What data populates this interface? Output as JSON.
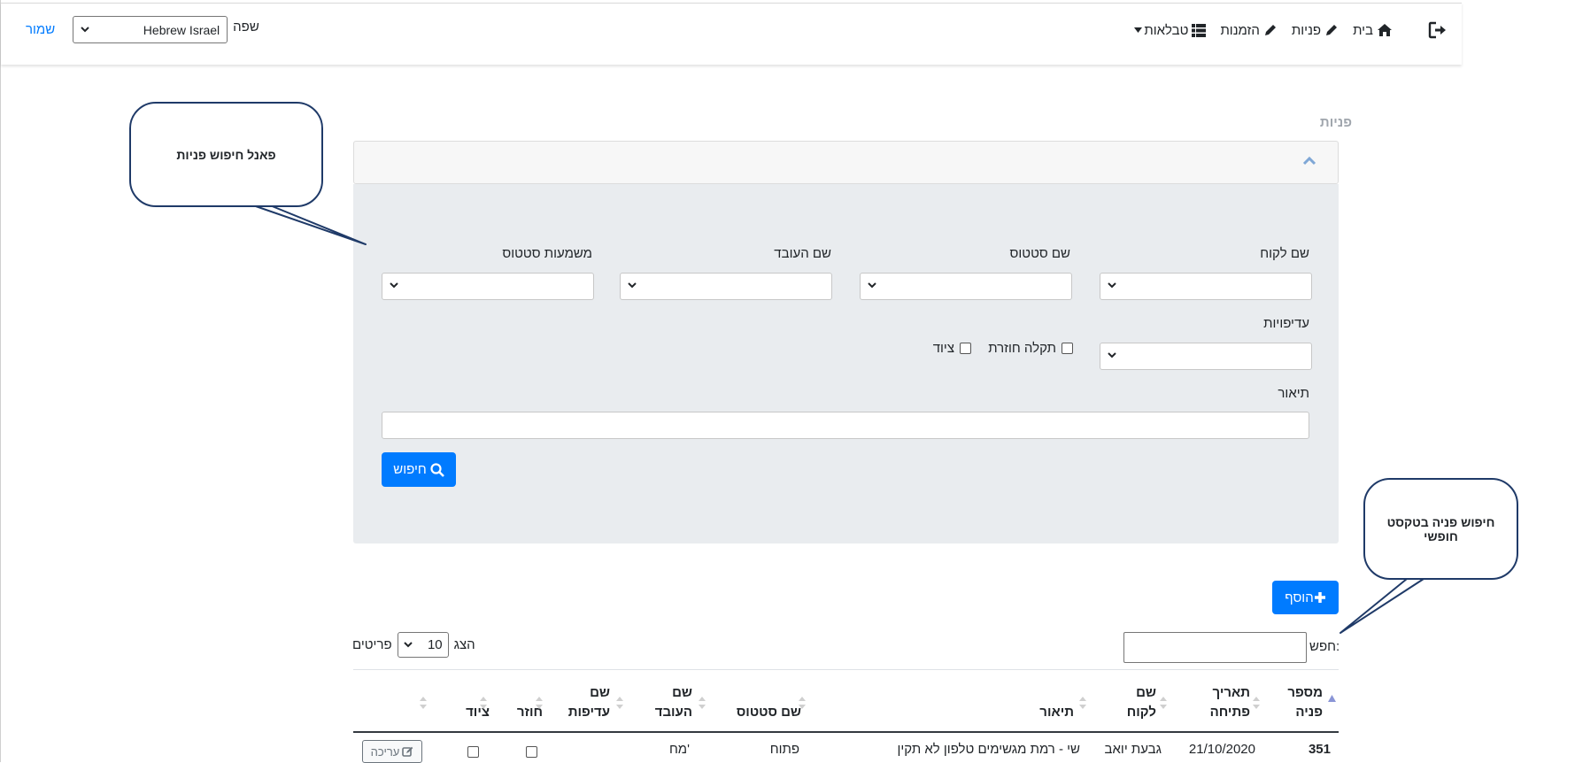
{
  "nav": {
    "home": "בית",
    "requests": "פניות",
    "orders": "הזמנות",
    "tables": "טבלאות"
  },
  "lang": {
    "label": "שפה",
    "value": "Hebrew Israel",
    "save": "שמור"
  },
  "page_title": "פניות",
  "filters": {
    "customer_name": "שם לקוח",
    "status_name": "שם סטטוס",
    "worker_name": "שם העובד",
    "status_meaning": "משמעות סטטוס",
    "priorities": "עדיפויות",
    "recurring_fault": "תקלה חוזרת",
    "equipment": "ציוד",
    "description": "תיאור",
    "search_button": "חיפוש"
  },
  "table_controls": {
    "add_button": "הוסף",
    "search_label": "חפש:",
    "show_label": "הצג",
    "page_length": "10",
    "items_label": "פריטים"
  },
  "columns": [
    {
      "line1": "מספר",
      "line2": "פניה"
    },
    {
      "line1": "תאריך",
      "line2": "פתיחה"
    },
    {
      "line1": "שם",
      "line2": "לקוח"
    },
    {
      "line1": "",
      "line2": "תיאור"
    },
    {
      "line1": "",
      "line2": "שם סטטוס"
    },
    {
      "line1": "שם",
      "line2": "העובד"
    },
    {
      "line1": "שם",
      "line2": "עדיפות"
    },
    {
      "line1": "",
      "line2": "חוזר"
    },
    {
      "line1": "",
      "line2": "ציוד"
    }
  ],
  "rows": [
    {
      "id": "351",
      "open_date": "21/10/2020",
      "customer": "גבעת יואב",
      "description": "שי - רמת מגשימים טלפון לא תקין",
      "status": "פתוח",
      "worker": "מח'",
      "priority": "",
      "edit": "עריכה"
    }
  ],
  "callouts": {
    "panel": "פאנל חיפוש פניות",
    "free_search_line1": "חיפוש פניה בטקסט",
    "free_search_line2": "חופשי"
  },
  "colors": {
    "primary": "#007bff",
    "panel_bg": "#e9ecef",
    "callout_border": "#1f3a68"
  }
}
